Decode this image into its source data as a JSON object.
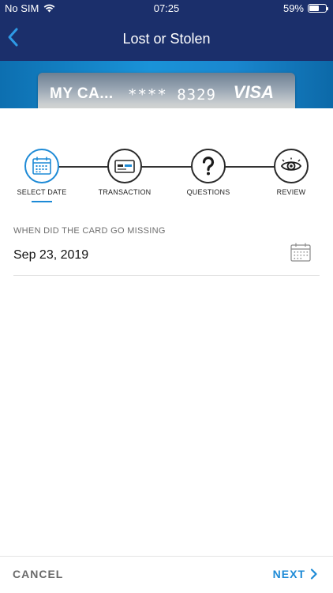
{
  "status_bar": {
    "carrier": "No SIM",
    "time": "07:25",
    "battery": "59%",
    "battery_level": 0.59
  },
  "nav": {
    "title": "Lost or Stolen",
    "back_icon": "chevron-left-icon"
  },
  "card": {
    "name": "MY CA...",
    "number": "**** 8329",
    "brand": "VISA"
  },
  "steps": [
    {
      "label": "SELECT DATE",
      "icon": "calendar-icon",
      "active": true
    },
    {
      "label": "TRANSACTION",
      "icon": "credit-card-icon",
      "active": false
    },
    {
      "label": "QUESTIONS",
      "icon": "question-icon",
      "active": false
    },
    {
      "label": "REVIEW",
      "icon": "eye-icon",
      "active": false
    }
  ],
  "form": {
    "field_label": "WHEN DID THE CARD GO MISSING",
    "date_value": "Sep 23, 2019",
    "date_icon": "calendar-icon"
  },
  "footer": {
    "cancel_label": "CANCEL",
    "next_label": "NEXT"
  },
  "colors": {
    "header": "#1b2f6b",
    "accent": "#1d8ad6",
    "band": "#1a93d8"
  }
}
